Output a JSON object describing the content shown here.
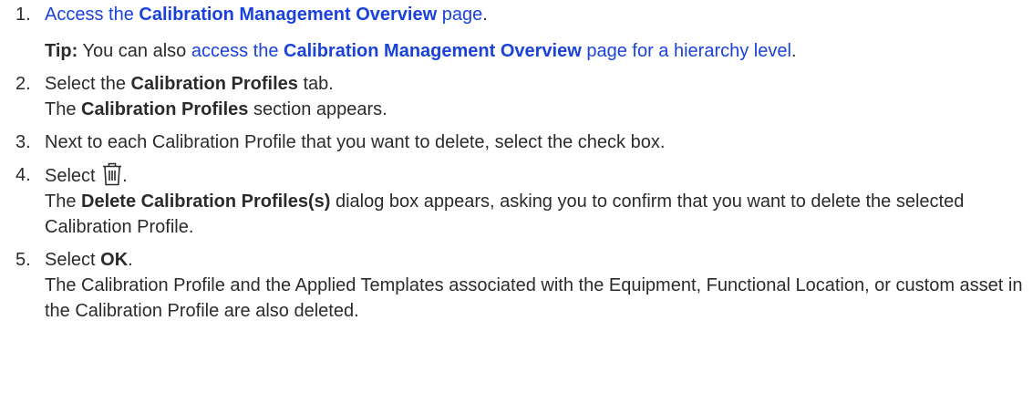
{
  "steps": [
    {
      "num": "1.",
      "pre": "",
      "link_pre": "Access the ",
      "link_bold": "Calibration Management Overview",
      "link_post": " page",
      "post": ".",
      "tip": {
        "label": "Tip:",
        "text": " You can also ",
        "link_pre": "access the ",
        "link_bold": "Calibration Management Overview",
        "link_post": " page for a hierarchy level",
        "post": "."
      }
    },
    {
      "num": "2.",
      "pre": "Select the ",
      "bold": "Calibration Profiles",
      "post": " tab.",
      "result_pre": "The ",
      "result_bold": "Calibration Profiles",
      "result_post": " section appears."
    },
    {
      "num": "3.",
      "text": "Next to each Calibration Profile that you want to delete, select the check box."
    },
    {
      "num": "4.",
      "pre": "Select ",
      "icon": "trash-icon",
      "post": ".",
      "result_pre": "The ",
      "result_bold": "Delete Calibration Profiles(s)",
      "result_post": " dialog box appears, asking you to confirm that you want to delete the selected Calibration Profile."
    },
    {
      "num": "5.",
      "pre": "Select ",
      "bold": "OK",
      "post": ".",
      "result_text": "The Calibration Profile and the Applied Templates associated with the Equipment, Functional Location, or custom asset in the Calibration Profile are also deleted."
    }
  ],
  "colors": {
    "link": "#1a42d9",
    "text": "#2b2b2b"
  }
}
